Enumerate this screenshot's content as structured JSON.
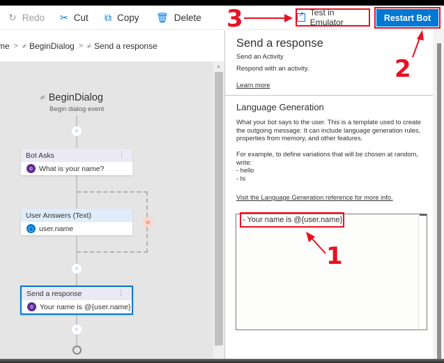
{
  "toolbar": {
    "items": [
      {
        "label": "Redo",
        "icon": "redo-icon",
        "disabled": true
      },
      {
        "label": "Cut",
        "icon": "cut-icon",
        "disabled": false
      },
      {
        "label": "Copy",
        "icon": "copy-icon",
        "disabled": false
      },
      {
        "label": "Delete",
        "icon": "delete-icon",
        "disabled": false
      }
    ],
    "emulator_label": "Test in Emulator",
    "restart_label": "Restart Bot"
  },
  "breadcrumb": {
    "items": [
      "me",
      "BeginDialog",
      "Send a response"
    ],
    "separator": ">"
  },
  "canvas": {
    "trigger_title": "BeginDialog",
    "trigger_subtitle": "Begin dialog event",
    "nodes": [
      {
        "header": "Bot Asks",
        "body": "What is your name?",
        "icon": "bot-icon"
      },
      {
        "header": "User Answers (Text)",
        "body": "user.name",
        "icon": "user-icon"
      },
      {
        "header": "Send a response",
        "body": "Your name is @{user.name}",
        "icon": "bot-icon",
        "selected": true
      }
    ],
    "add_symbol": "+",
    "kebab_symbol": "⋮"
  },
  "panel": {
    "title": "Send a response",
    "subtitle": "Send an Activity",
    "description": "Respond with an activity.",
    "learn_more": "Learn more",
    "lg_title": "Language Generation",
    "lg_text": "What your bot says to the user. This is a template used to create the outgoing message. It can include language generation rules, properties from memory, and other features.\n\nFor example, to define variations that will be chosen at random, write:\n- hello\n- hi",
    "lg_link": "Visit the Language Generation reference for more info.",
    "editor_value": "- Your name is @{user.name}"
  },
  "annotations": {
    "one": "1",
    "two": "2",
    "three": "3",
    "color": "#e81123"
  },
  "colors": {
    "accent": "#0078d4",
    "annotation": "#e81123"
  }
}
